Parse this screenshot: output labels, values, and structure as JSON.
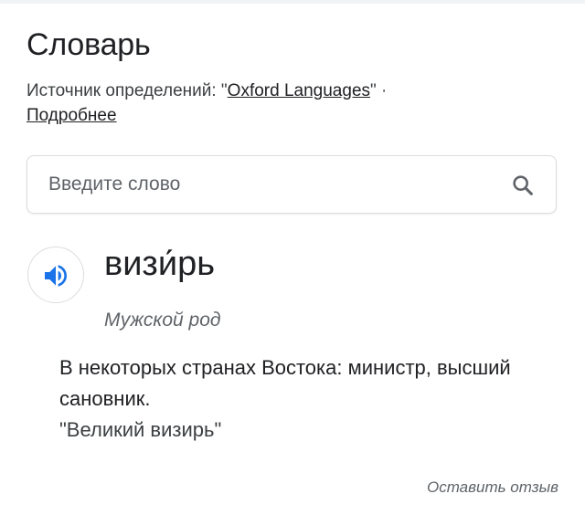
{
  "header": {
    "title": "Словарь",
    "source_prefix": "Источник определений: \"",
    "source_link": "Oxford Languages",
    "source_suffix": "\" · ",
    "more_link": "Подробнее"
  },
  "search": {
    "placeholder": "Введите слово",
    "icon": "search-icon"
  },
  "entry": {
    "pronounce_icon": "speaker-icon",
    "headword": "визи́рь",
    "part_of_speech": "Мужской род",
    "definition": "В некоторых странах Востока: министр, высший сановник.",
    "example": "\"Великий визирь\""
  },
  "footer": {
    "feedback_label": "Оставить отзыв"
  },
  "colors": {
    "accent": "#1a73e8",
    "text": "#202124",
    "secondary": "#5f6368",
    "border": "#dadce0"
  }
}
